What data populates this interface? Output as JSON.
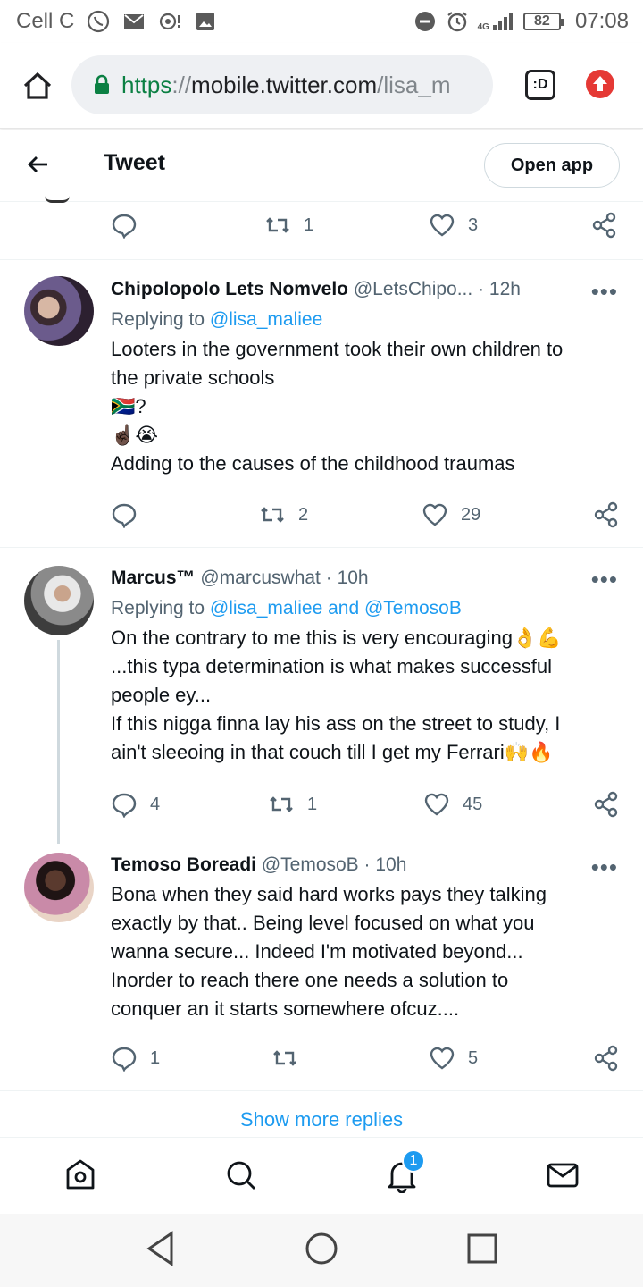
{
  "status_bar": {
    "carrier": "Cell C",
    "network": "4G",
    "battery": "82",
    "time": "07:08"
  },
  "browser": {
    "url_scheme": "https",
    "url_sep": "://",
    "url_host": "mobile.twitter.com",
    "url_path": "/lisa_m",
    "tab_count": ":D"
  },
  "header": {
    "title": "Tweet",
    "open_app": "Open app"
  },
  "top_actions": {
    "retweets": "1",
    "likes": "3"
  },
  "tweets": [
    {
      "name": "Chipolopolo Lets Nomvelo",
      "handle": "@LetsChipo...",
      "time": "· 12h",
      "replying_prefix": "Replying to",
      "replying_to": "@lisa_maliee",
      "lines": [
        "Looters in the government took their own children to",
        "the private schools",
        "🇿🇦?",
        "☝🏿😭",
        "Adding to the causes of the childhood traumas"
      ],
      "replies": "",
      "retweets": "2",
      "likes": "29"
    },
    {
      "name": "Marcus™",
      "handle": "@marcuswhat",
      "time": "· 10h",
      "replying_prefix": "Replying to",
      "replying_to": "@lisa_maliee and @TemosoB",
      "lines": [
        "On the contrary to me this is very encouraging👌💪",
        "...this typa determination is what makes successful",
        "people ey...",
        "If this nigga finna lay his ass on the street to study, I",
        "ain't sleeoing in that couch till I get my Ferrari🙌🔥"
      ],
      "replies": "4",
      "retweets": "1",
      "likes": "45"
    },
    {
      "name": "Temoso Boreadi",
      "handle": "@TemosoB",
      "time": "· 10h",
      "lines": [
        "Bona when they said hard works pays they talking",
        "exactly by that.. Being level focused on what you",
        "wanna secure... Indeed I'm motivated beyond...",
        "Inorder to reach there one needs a solution to",
        "conquer an it starts somewhere ofcuz...."
      ],
      "replies": "1",
      "retweets": "",
      "likes": "5"
    }
  ],
  "more_label": "•••",
  "show_more": "Show more replies",
  "bottom_nav": {
    "notifications_badge": "1"
  },
  "colors": {
    "accent": "#1d9bf0",
    "text": "#0f1419",
    "muted": "#536471",
    "divider": "#eff3f4",
    "lock": "#0b8043"
  }
}
